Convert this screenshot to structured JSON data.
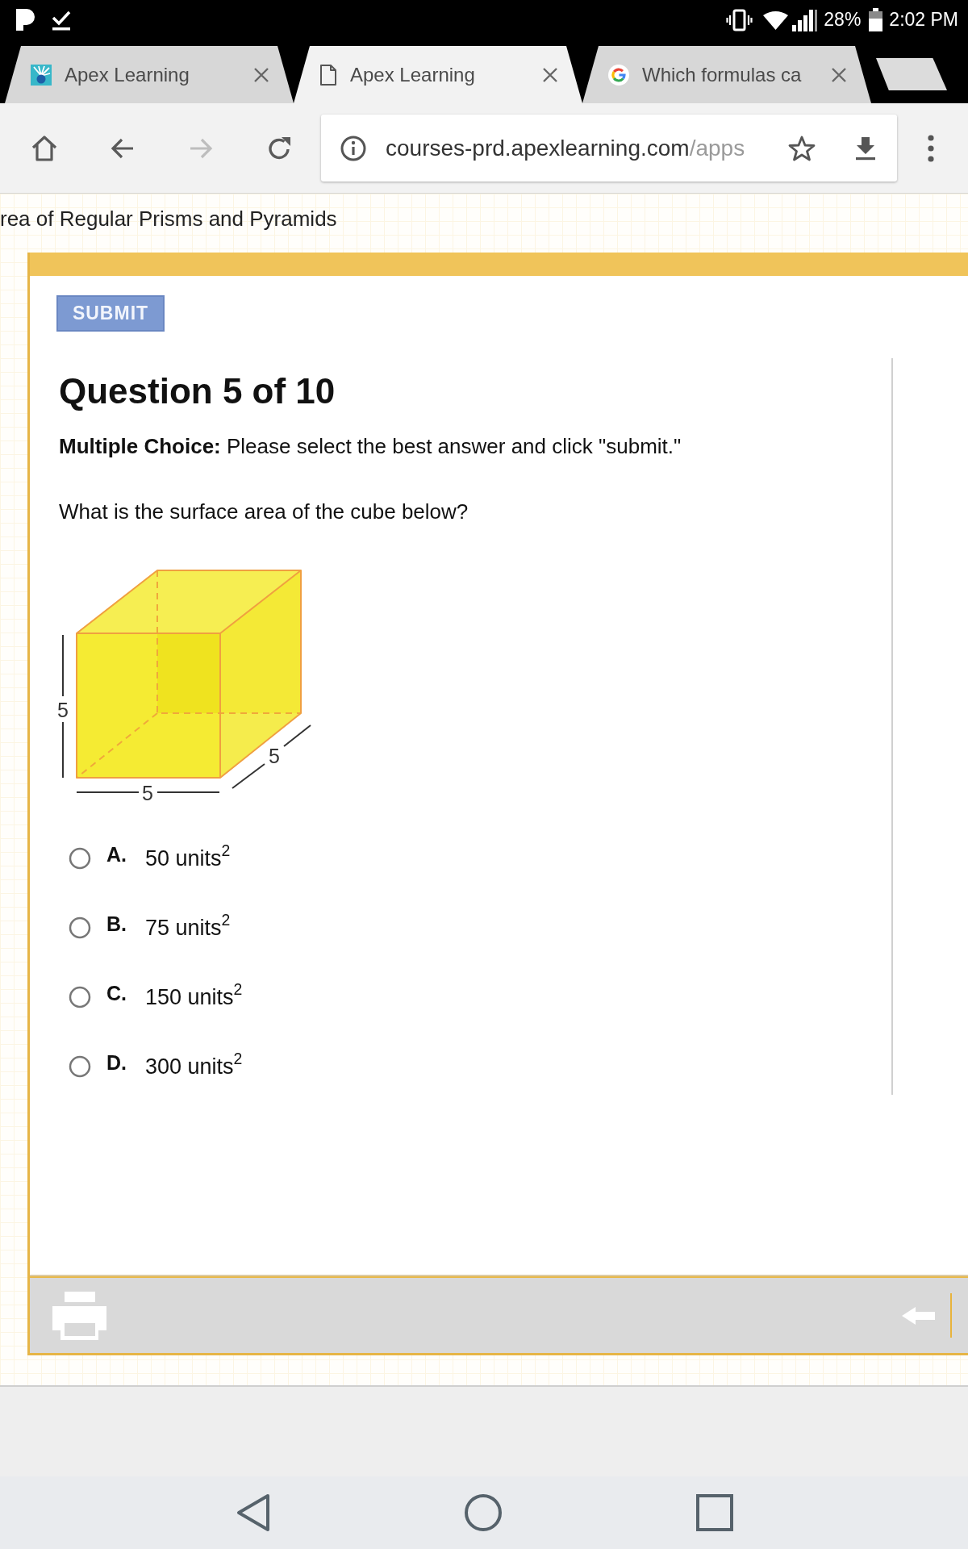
{
  "status_bar": {
    "battery": "28%",
    "time": "2:02 PM"
  },
  "tabs": [
    {
      "kind": "apex",
      "title": "Apex Learning",
      "selected": false
    },
    {
      "kind": "document",
      "title": "Apex Learning",
      "selected": true
    },
    {
      "kind": "search",
      "title": "Which formulas ca",
      "selected": false
    }
  ],
  "toolbar": {
    "buttons": [
      {
        "kind": "home",
        "disabled": false
      },
      {
        "kind": "back",
        "disabled": false
      },
      {
        "kind": "forward",
        "disabled": true
      },
      {
        "kind": "reload",
        "disabled": false
      }
    ],
    "address_bar": {
      "host": "courses-prd.apexlearning.com",
      "path": "/apps"
    }
  },
  "page": {
    "lesson_title": "rea of Regular Prisms and Pyramids",
    "submit": "SUBMIT",
    "heading": "Question 5 of 10",
    "instructions": "**Multiple Choice:** Please select the best answer and click \"submit.\"",
    "question": "What is the surface area of the cube below?",
    "figure": {
      "height_label": "5",
      "width_label": "5",
      "depth_label": "5"
    },
    "choices": [
      {
        "letter": "A.",
        "text": "50 units$^{2}$",
        "selected": false
      },
      {
        "letter": "B.",
        "text": "75 units$^{2}$",
        "selected": false
      },
      {
        "letter": "C.",
        "text": "150 units$^{2}$",
        "selected": false
      },
      {
        "letter": "D.",
        "text": "300 units$^{2}$",
        "selected": false
      }
    ]
  }
}
